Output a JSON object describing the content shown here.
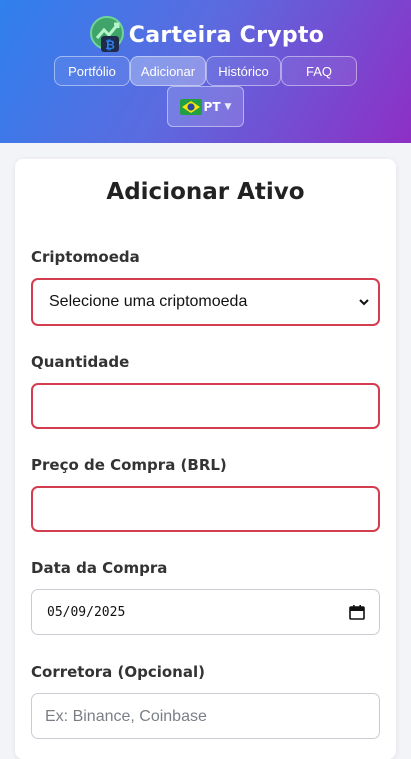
{
  "app": {
    "title": "Carteira Crypto"
  },
  "nav": {
    "items": [
      {
        "label": "Portfólio"
      },
      {
        "label": "Adicionar"
      },
      {
        "label": "Histórico"
      },
      {
        "label": "FAQ"
      }
    ],
    "active": "Adicionar"
  },
  "language": {
    "code": "PT",
    "flag": "brazil-flag-icon"
  },
  "form": {
    "title": "Adicionar Ativo",
    "crypto": {
      "label": "Criptomoeda",
      "value": "Selecione uma criptomoeda"
    },
    "quantity": {
      "label": "Quantidade",
      "value": ""
    },
    "price": {
      "label": "Preço de Compra (BRL)",
      "value": ""
    },
    "date": {
      "label": "Data da Compra",
      "value": "05/09/2025"
    },
    "broker": {
      "label": "Corretora (Opcional)",
      "placeholder": "Ex: Binance, Coinbase"
    }
  },
  "colors": {
    "header_start": "#2f80ed",
    "header_end": "#8e2fc4",
    "error_border": "#d43d4f"
  }
}
